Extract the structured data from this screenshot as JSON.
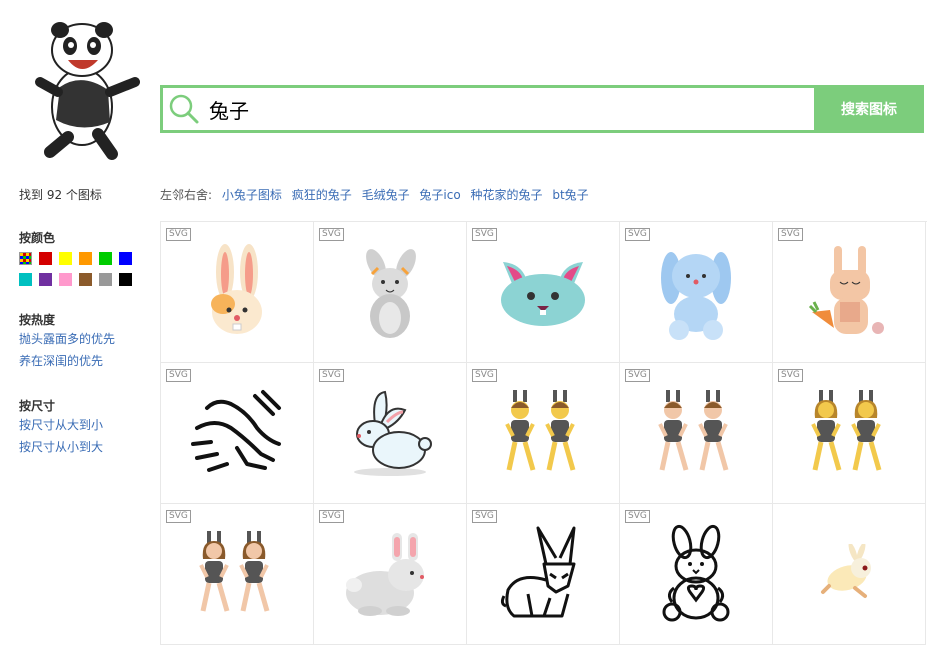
{
  "search": {
    "query": "兔子",
    "button_label": "搜索图标"
  },
  "sidebar": {
    "found_text": "找到 92 个图标",
    "color_title": "按颜色",
    "colors": [
      "#ffffff",
      "#d40000",
      "#ffff00",
      "#ff9900",
      "#00cc00",
      "#0000ff",
      "#00c0c0",
      "#7030a0",
      "#ff99cc",
      "#8b5a2b",
      "#999999",
      "#000000"
    ],
    "heat_title": "按热度",
    "heat_links": [
      "抛头露面多的优先",
      "养在深闺的优先"
    ],
    "size_title": "按尺寸",
    "size_links": [
      "按尺寸从大到小",
      "按尺寸从小到大"
    ]
  },
  "related": {
    "label": "左邻右舍:",
    "links": [
      "小兔子图标",
      "疯狂的兔子",
      "毛绒兔子",
      "兔子ico",
      "种花家的兔子",
      "bt兔子"
    ]
  },
  "icons": [
    {
      "badge": "SVG",
      "name": "rabbit-face-icon"
    },
    {
      "badge": "SVG",
      "name": "gray-rabbit-icon"
    },
    {
      "badge": "SVG",
      "name": "teal-bunny-face-icon"
    },
    {
      "badge": "SVG",
      "name": "blue-plush-bunny-icon"
    },
    {
      "badge": "SVG",
      "name": "rabbit-with-carrot-icon"
    },
    {
      "badge": "SVG",
      "name": "running-rabbit-outline-icon"
    },
    {
      "badge": "SVG",
      "name": "white-rabbit-icon"
    },
    {
      "badge": "SVG",
      "name": "bunny-dancers-yellow-icon"
    },
    {
      "badge": "SVG",
      "name": "bunny-dancers-light-icon"
    },
    {
      "badge": "SVG",
      "name": "bunny-dancers-women-yellow-icon"
    },
    {
      "badge": "SVG",
      "name": "bunny-dancers-women-light-icon"
    },
    {
      "badge": "SVG",
      "name": "sitting-gray-rabbit-icon"
    },
    {
      "badge": "SVG",
      "name": "rabbit-line-icon"
    },
    {
      "badge": "SVG",
      "name": "teddy-bunny-outline-icon"
    },
    {
      "badge": "",
      "name": "leaping-cream-rabbit-icon"
    }
  ]
}
